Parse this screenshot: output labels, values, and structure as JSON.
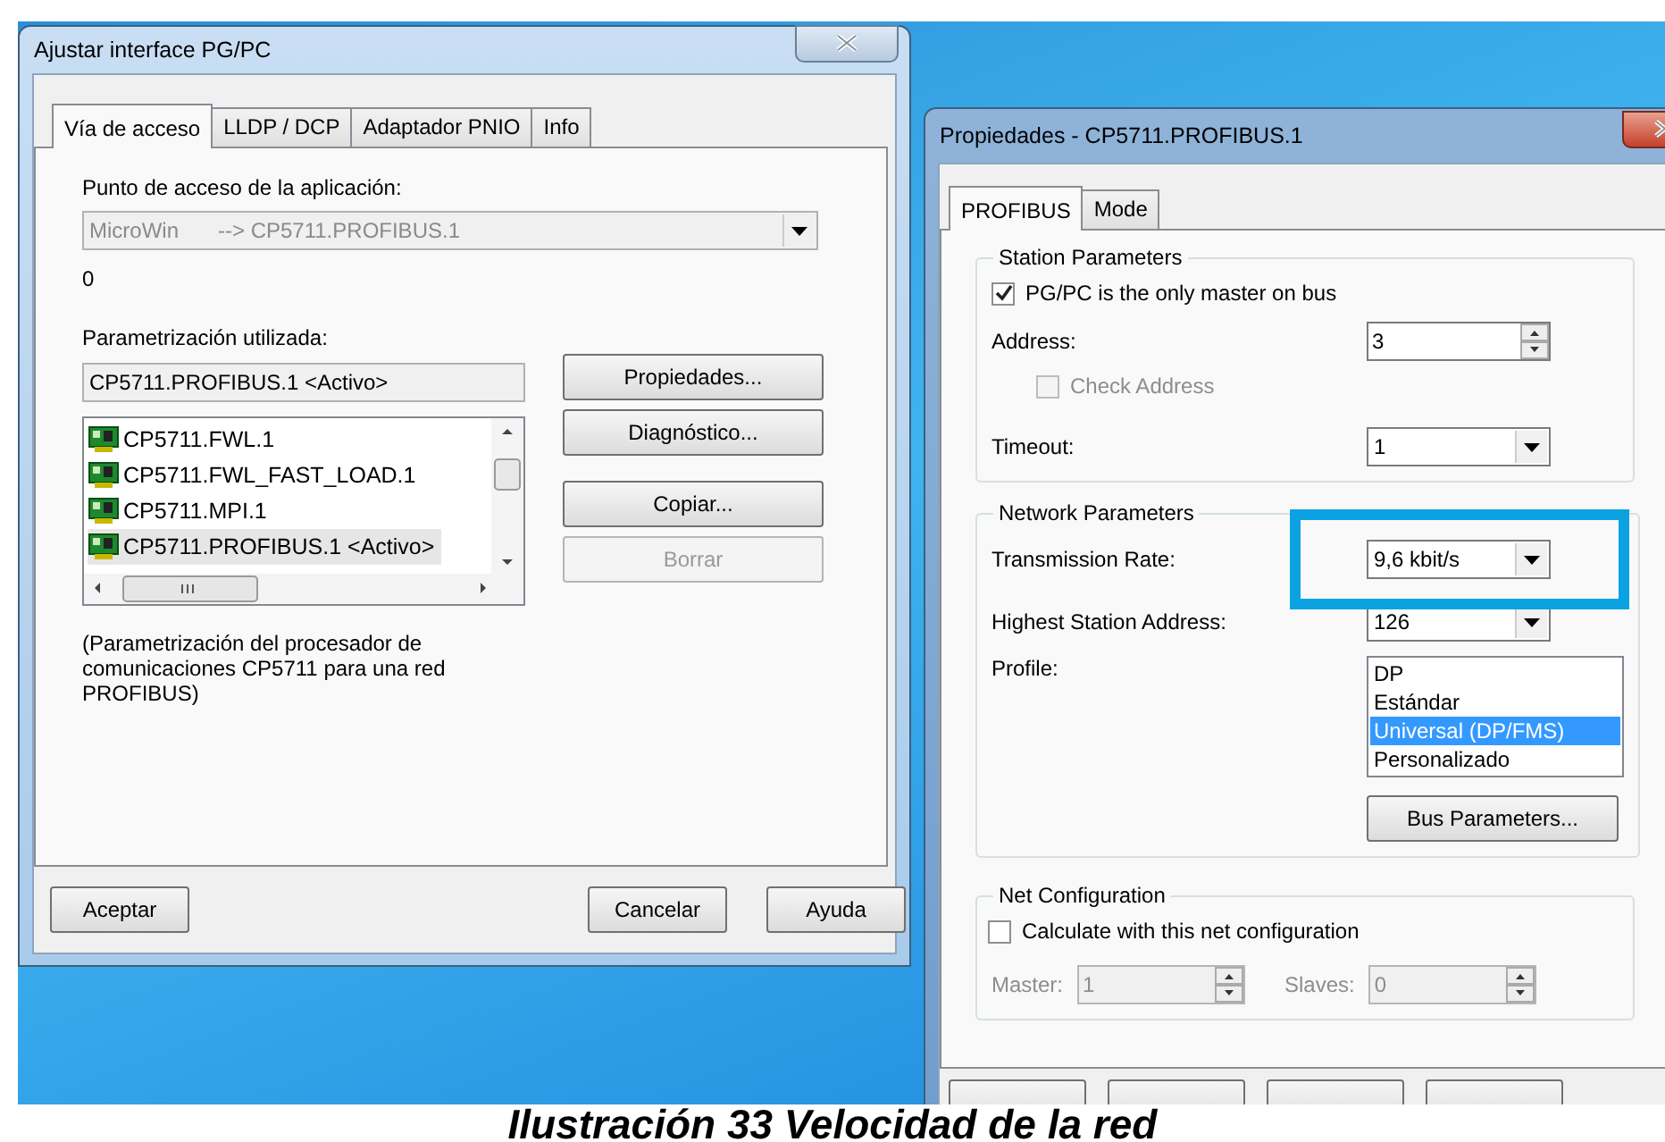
{
  "left_dialog": {
    "title": "Ajustar interface PG/PC",
    "tabs": [
      {
        "label": "Vía de acceso",
        "selected": true
      },
      {
        "label": "LLDP / DCP",
        "selected": false
      },
      {
        "label": "Adaptador PNIO",
        "selected": false
      },
      {
        "label": "Info",
        "selected": false
      }
    ],
    "access_point_label": "Punto de acceso de la aplicación:",
    "access_point": {
      "name": "MicroWin",
      "target": "--> CP5711.PROFIBUS.1",
      "disabled": true
    },
    "access_point_note": "0",
    "parametrization_label": "Parametrización utilizada:",
    "parametrization_value": "CP5711.PROFIBUS.1  <Activo>",
    "interfaces": [
      {
        "label": "CP5711.FWL.1",
        "selected": false
      },
      {
        "label": "CP5711.FWL_FAST_LOAD.1",
        "selected": false
      },
      {
        "label": "CP5711.MPI.1",
        "selected": false
      },
      {
        "label": "CP5711.PROFIBUS.1  <Activo>",
        "selected": true
      }
    ],
    "side_buttons": [
      {
        "label": "Propiedades...",
        "disabled": false
      },
      {
        "label": "Diagnóstico...",
        "disabled": false
      },
      {
        "label": "Copiar...",
        "disabled": false
      },
      {
        "label": "Borrar",
        "disabled": true
      }
    ],
    "description": "(Parametrización del procesador de comunicaciones CP5711 para una red PROFIBUS)",
    "buttons": [
      "Aceptar",
      "Cancelar",
      "Ayuda"
    ]
  },
  "right_dialog": {
    "title": "Propiedades - CP5711.PROFIBUS.1",
    "tabs": [
      {
        "label": "PROFIBUS",
        "selected": true
      },
      {
        "label": "Mode",
        "selected": false
      }
    ],
    "station_parameters": {
      "title": "Station Parameters",
      "only_master": {
        "label": "PG/PC is the only master on bus",
        "checked": true,
        "disabled": false
      },
      "address": {
        "label": "Address:",
        "value": "3"
      },
      "check_address": {
        "label": "Check Address",
        "checked": false,
        "disabled": true
      },
      "timeout": {
        "label": "Timeout:",
        "value": "1"
      }
    },
    "network_parameters": {
      "title": "Network Parameters",
      "transmission_rate": {
        "label": "Transmission Rate:",
        "value": "9,6 kbit/s"
      },
      "highest_station_address": {
        "label": "Highest Station Address:",
        "value": "126"
      },
      "profile": {
        "label": "Profile:",
        "options": [
          {
            "label": "DP",
            "selected": false
          },
          {
            "label": "Estándar",
            "selected": false
          },
          {
            "label": "Universal (DP/FMS)",
            "selected": true
          },
          {
            "label": "Personalizado",
            "selected": false
          }
        ]
      },
      "bus_parameters_button": "Bus Parameters..."
    },
    "net_configuration": {
      "title": "Net Configuration",
      "calculate": {
        "label": "Calculate with this net configuration",
        "checked": false,
        "disabled": false
      },
      "master": {
        "label": "Master:",
        "value": "1",
        "disabled": true
      },
      "slaves": {
        "label": "Slaves:",
        "value": "0",
        "disabled": true
      }
    }
  },
  "caption": "Ilustración 33 Velocidad de la red"
}
